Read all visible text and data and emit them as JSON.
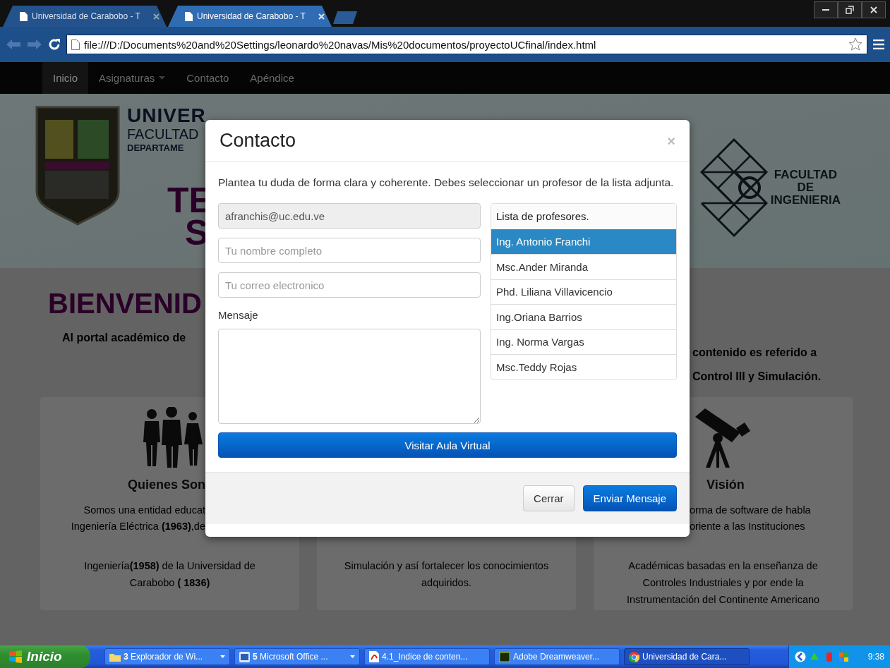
{
  "browser": {
    "tabs": [
      {
        "title": "Universidad de Carabobo - T",
        "selected": false
      },
      {
        "title": "Universidad de Carabobo - T",
        "selected": true
      }
    ],
    "address": "file:///D:/Documents%20and%20Settings/leonardo%20navas/Mis%20documentos/proyectoUCfinal/index.html"
  },
  "navbar": {
    "items": [
      {
        "label": "Inicio",
        "selected": true,
        "dropdown": false
      },
      {
        "label": "Asignaturas",
        "selected": false,
        "dropdown": true
      },
      {
        "label": "Contacto",
        "selected": false,
        "dropdown": false
      },
      {
        "label": "Apéndice",
        "selected": false,
        "dropdown": false
      }
    ]
  },
  "header": {
    "title": "UNIVER",
    "faculty": "FACULTAD",
    "department": "DEPARTAME",
    "subtitle_lines": [
      "TE",
      "S"
    ],
    "emblem_text": [
      "FACULTAD",
      "DE",
      "INGENIERIA"
    ]
  },
  "welcome": {
    "heading": "BIENVENID",
    "left_text": "Al portal académico de",
    "right_lines": [
      "contenido es referido a",
      "Control III y Simulación."
    ]
  },
  "cards": [
    {
      "title": "Quienes Son",
      "top_lines": [
        "Somos una entidad educat",
        "Ingeniería Eléctrica **(1963)**,de"
      ],
      "bottom_lines": [
        "Ingeniería**(1958)** de la Universidad de",
        "Carabobo **( 1836)**"
      ]
    },
    {
      "bottom_lines": [
        "Simulación y así fortalecer los conocimientos",
        "adquiridos."
      ]
    },
    {
      "title": "Visión",
      "top_lines": [
        "orma de software de habla",
        "oriente a las Instituciones"
      ],
      "bottom_lines": [
        "Académicas basadas en la enseñanza de",
        "Controles Industriales y por ende la",
        "Instrumentación del Continente Americano"
      ]
    }
  ],
  "modal": {
    "title": "Contacto",
    "close": "×",
    "intro": "Plantea tu duda de forma clara y coherente. Debes seleccionar un profesor de la lista adjunta.",
    "fields": [
      {
        "kind": "readonly",
        "value": "afranchis@uc.edu.ve"
      },
      {
        "kind": "text",
        "placeholder": "Tu nombre completo"
      },
      {
        "kind": "text",
        "placeholder": "Tu correo electronico"
      }
    ],
    "message_label": "Mensaje",
    "list": [
      {
        "kind": "header",
        "label": "Lista de profesores.",
        "selected": false
      },
      {
        "kind": "option",
        "label": "Ing. Antonio Franchi",
        "selected": true
      },
      {
        "kind": "option",
        "label": "Msc.Ander Miranda",
        "selected": false
      },
      {
        "kind": "option",
        "label": "Phd. Liliana Villavicencio",
        "selected": false
      },
      {
        "kind": "option",
        "label": "Ing.Oriana Barrios",
        "selected": false
      },
      {
        "kind": "option",
        "label": "Ing. Norma Vargas",
        "selected": false
      },
      {
        "kind": "option",
        "label": "Msc.Teddy Rojas",
        "selected": false
      }
    ],
    "wide_button": "Visitar Aula Virtual",
    "buttons": [
      {
        "kind": "default",
        "label": "Cerrar"
      },
      {
        "kind": "primary",
        "label": "Enviar Mensaje"
      }
    ]
  },
  "taskbar": {
    "start": "Inicio",
    "buttons": [
      {
        "count": "3",
        "label": "Explorador de Wi...",
        "group": true,
        "selected": false
      },
      {
        "count": "5",
        "label": "Microsoft Office ...",
        "group": true,
        "selected": false
      },
      {
        "label": "4.1_Indice de conten...",
        "group": false,
        "selected": false
      },
      {
        "label": "Adobe Dreamweaver...",
        "group": false,
        "selected": false
      },
      {
        "label": "Universidad de Cara...",
        "group": false,
        "selected": true
      }
    ],
    "clock": "9:38"
  }
}
